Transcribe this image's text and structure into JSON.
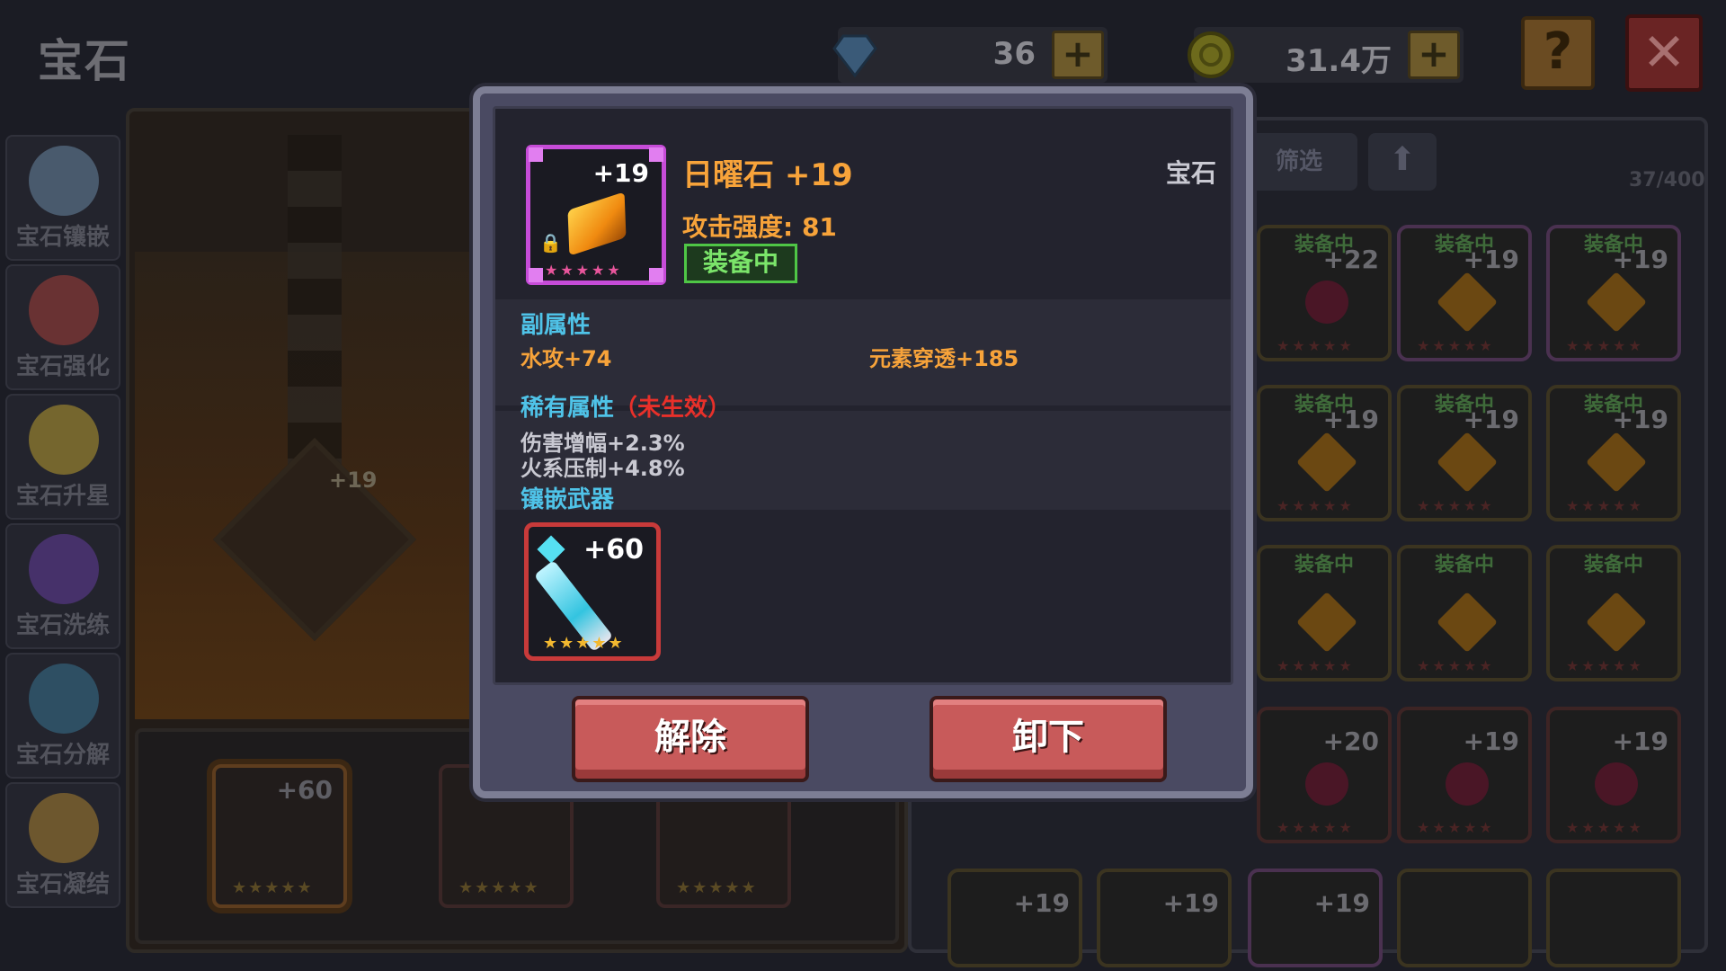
{
  "header": {
    "title": "宝石",
    "diamond": {
      "value": "36",
      "icon": "diamond-icon"
    },
    "gold": {
      "value": "31.4万",
      "icon": "gold-coin-icon"
    },
    "plus_label": "+",
    "help_label": "?",
    "close_label": "✕"
  },
  "menu": {
    "items": [
      {
        "label": "宝石镶嵌",
        "icon": "gem-inlay-icon",
        "color": "#6f8fae"
      },
      {
        "label": "宝石强化",
        "icon": "gem-enhance-icon",
        "color": "#b0403a"
      },
      {
        "label": "宝石升星",
        "icon": "star-icon",
        "color": "#c8a830"
      },
      {
        "label": "宝石洗练",
        "icon": "gem-refine-icon",
        "color": "#6a3ea8"
      },
      {
        "label": "宝石分解",
        "icon": "gem-decompose-icon",
        "color": "#3a7a9a"
      },
      {
        "label": "宝石凝结",
        "icon": "gem-condense-icon",
        "color": "#b88a30"
      }
    ]
  },
  "center": {
    "socket_plus": "+19",
    "tray": [
      {
        "plus": "+60",
        "stars": "★★★★★"
      },
      {
        "plus": "",
        "stars": "★★★★★"
      },
      {
        "plus": "",
        "stars": "★★★★★"
      }
    ]
  },
  "inventory": {
    "filter_label": "筛选",
    "sort_icon": "up-arrow-icon",
    "count": "37/400",
    "equipped_label": "装备中",
    "cells": [
      {
        "equipped": true,
        "plus": "+22",
        "kind": "red",
        "frame": "gold"
      },
      {
        "equipped": true,
        "plus": "+19",
        "kind": "gold",
        "frame": "purple"
      },
      {
        "equipped": true,
        "plus": "+19",
        "kind": "gold",
        "frame": "purple"
      },
      {
        "equipped": true,
        "plus": "+19",
        "kind": "gold",
        "frame": "gold"
      },
      {
        "equipped": true,
        "plus": "+19",
        "kind": "gold",
        "frame": "gold"
      },
      {
        "equipped": true,
        "plus": "+19",
        "kind": "gold",
        "frame": "gold"
      },
      {
        "equipped": true,
        "plus": "",
        "kind": "gold",
        "frame": "gold"
      },
      {
        "equipped": true,
        "plus": "",
        "kind": "gold",
        "frame": "gold"
      },
      {
        "equipped": true,
        "plus": "",
        "kind": "gold",
        "frame": "gold"
      },
      {
        "equipped": false,
        "plus": "+20",
        "kind": "red",
        "frame": "red"
      },
      {
        "equipped": false,
        "plus": "+19",
        "kind": "red",
        "frame": "red"
      },
      {
        "equipped": false,
        "plus": "+19",
        "kind": "red",
        "frame": "red"
      }
    ],
    "bottom_row": [
      {
        "plus": "+19"
      },
      {
        "plus": "+19"
      },
      {
        "plus": "+19"
      },
      {
        "plus": ""
      },
      {
        "plus": ""
      }
    ]
  },
  "dialog": {
    "gem_name": "日曜石 +19",
    "gem_plus": "+19",
    "gem_icon": "sun-stone-icon",
    "gem_type": "宝石",
    "attack": "攻击强度: 81",
    "equipped_badge": "装备中",
    "sub_header": "副属性",
    "sub_attrs": [
      "水攻+74",
      "元素穿透+185"
    ],
    "rare_header": "稀有属性",
    "rare_note": "（未生效）",
    "rare_attrs": [
      "伤害增幅+2.3%",
      "火系压制+4.8%"
    ],
    "weapon_header": "镶嵌武器",
    "weapon_plus": "+60",
    "weapon_icon": "spear-weapon-icon",
    "stars": "★★★★★",
    "unbind_label": "解除",
    "unequip_label": "卸下",
    "colors": {
      "accent": "#f7a33a",
      "section": "#4fc3e8",
      "warn": "#e8302a",
      "equipped": "#4fc646"
    }
  }
}
